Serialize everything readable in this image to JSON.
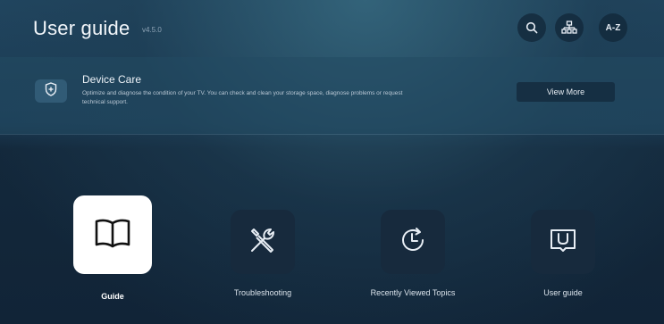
{
  "header": {
    "title": "User guide",
    "version": "v4.5.0",
    "buttons": [
      {
        "icon": "search-icon",
        "label": ""
      },
      {
        "icon": "sitemap-icon",
        "label": ""
      },
      {
        "icon": "a-z-icon",
        "label": "A-Z"
      }
    ]
  },
  "device_care": {
    "icon": "shield-icon",
    "title": "Device Care",
    "description": "Optimize and diagnose the condition of your TV. You can check and clean your storage space, diagnose problems or request technical support.",
    "button_label": "View More"
  },
  "tiles": [
    {
      "icon": "book-icon",
      "label": "Guide",
      "focused": true
    },
    {
      "icon": "tools-icon",
      "label": "Troubleshooting",
      "focused": false
    },
    {
      "icon": "history-icon",
      "label": "Recently Viewed Topics",
      "focused": false
    },
    {
      "icon": "user-guide-book-icon",
      "label": "User guide",
      "focused": false
    }
  ]
}
